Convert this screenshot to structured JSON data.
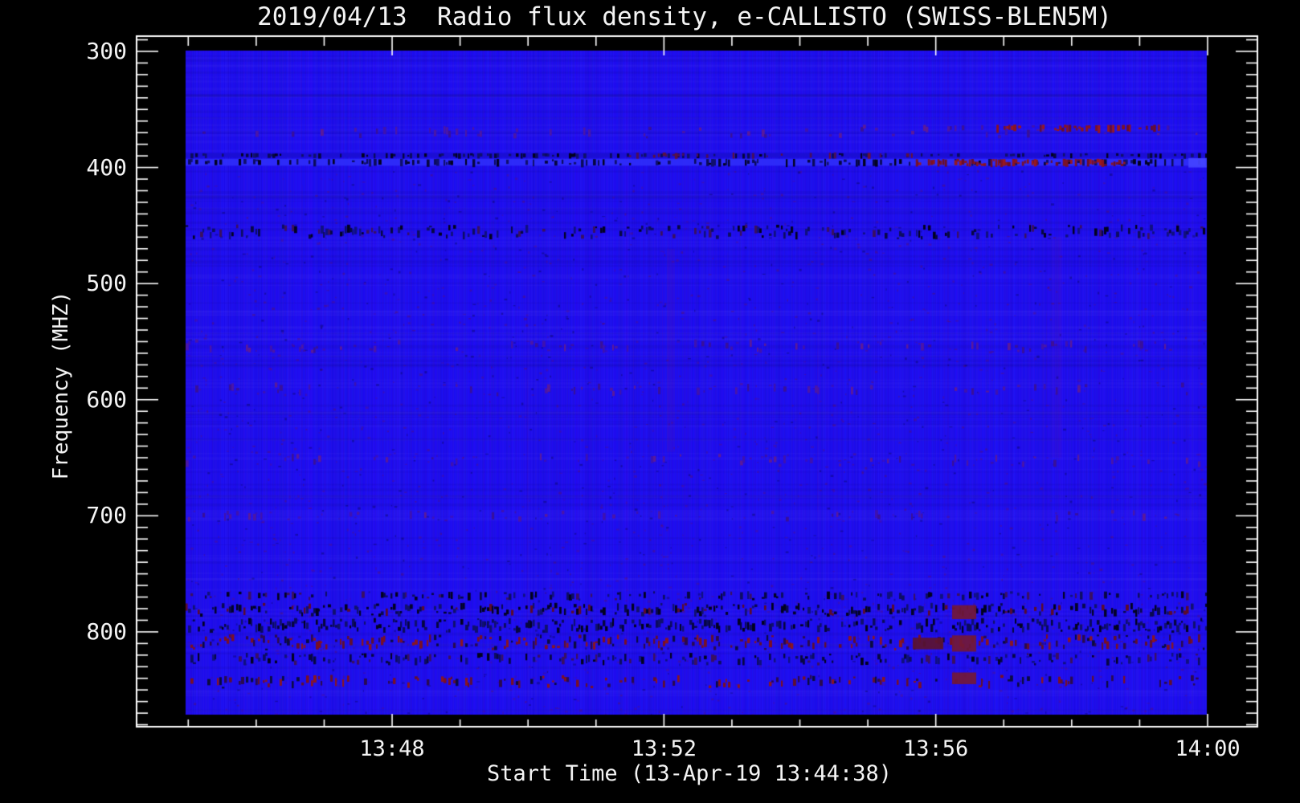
{
  "window": {
    "background": "#000000",
    "text_color": "#f4f4f4",
    "frame_color": "#ffffff"
  },
  "chart_data": {
    "type": "heatmap",
    "title": "2019/04/13  Radio flux density, e-CALLISTO (SWISS-BLEN5M)",
    "xlabel": "Start Time (13-Apr-19 13:44:38)",
    "ylabel": "Frequency (MHZ)",
    "legend": "none",
    "grid": "off",
    "x_axis": {
      "start_time": "13:44:38",
      "end_time": "14:00:00",
      "major_ticks": [
        {
          "label": "13:48",
          "minute": 48
        },
        {
          "label": "13:52",
          "minute": 52
        },
        {
          "label": "13:56",
          "minute": 56
        },
        {
          "label": "14:00",
          "minute": 60
        }
      ],
      "minor_tick_minutes": [
        45,
        46,
        47,
        49,
        50,
        51,
        53,
        54,
        55,
        57,
        58,
        59
      ]
    },
    "y_axis": {
      "unit": "MHZ",
      "direction": "increasing-downward",
      "major_ticks": [
        300,
        400,
        500,
        600,
        700,
        800
      ],
      "minor_step_mhz": 10,
      "minor_range_mhz": [
        290,
        880
      ],
      "image_range_mhz": [
        298,
        872
      ]
    },
    "base_color": "#2111EB",
    "palettes": {
      "dark": [
        "#02021f",
        "#060640",
        "#0b0b5e",
        "#10106e"
      ],
      "darkmix": [
        "#02021f",
        "#070745",
        "#0d0d62",
        "#3a1060",
        "#101080"
      ],
      "mix": [
        "#03032a",
        "#090950",
        "#5c0c2a",
        "#11116e",
        "#02021f"
      ],
      "redmix": [
        "#7a1024",
        "#8a1622",
        "#601030",
        "#2a0a50",
        "#0b0b40"
      ],
      "red": [
        "#8a1420",
        "#7a1228",
        "#981820",
        "#6a0e2a"
      ],
      "redweak": [
        "#5c1240",
        "#4a1058",
        "#6a1236"
      ],
      "purple": [
        "#4a16a8",
        "#3e12b0",
        "#5a1a9a",
        "#38109a"
      ],
      "darkblue": [
        "#1717c8",
        "#1212b4",
        "#0d0da0"
      ],
      "lightblue": [
        "#3333fa",
        "#2b2bf0",
        "#3a3aff"
      ],
      "bright": [
        "#4040ff",
        "#5050ff",
        "#3b3bff"
      ],
      "maroon": [
        "#731937"
      ],
      "maroon2": [
        "#5c1430"
      ]
    },
    "features": [
      {
        "name": "band-368-purple",
        "f0": 363,
        "f1": 375,
        "x0": 0,
        "x1": 1,
        "density": 0.16,
        "palette": "purple"
      },
      {
        "name": "band-366-red",
        "f0": 363,
        "f1": 369,
        "x0": 0.794,
        "x1": 0.963,
        "density": 0.5,
        "palette": "red"
      },
      {
        "name": "line-389",
        "f0": 387.5,
        "f1": 391,
        "x0": 0,
        "x1": 1,
        "density": 0.3,
        "palette": "dark",
        "fill": "#1b0ed2",
        "fillAlpha": 0.9
      },
      {
        "name": "line-389-red",
        "f0": 387,
        "f1": 392,
        "x0": 0.42,
        "x1": 0.715,
        "density": 0.18,
        "palette": "redweak"
      },
      {
        "name": "line-395",
        "f0": 392.5,
        "f1": 398.5,
        "x0": 0,
        "x1": 1,
        "density": 0.35,
        "palette": "dark",
        "fill": "#3030fa",
        "fillAlpha": 0.85
      },
      {
        "name": "line-395-red",
        "f0": 392.5,
        "f1": 399,
        "x0": 0.715,
        "x1": 0.92,
        "density": 0.7,
        "palette": "red"
      },
      {
        "name": "line-395-bright",
        "f0": 392,
        "f1": 400,
        "x0": 0.982,
        "x1": 1.0,
        "density": 0.2,
        "palette": "bright",
        "fill": "#4343ff",
        "fillAlpha": 0.95
      },
      {
        "name": "band-455-dark",
        "f0": 449,
        "f1": 462,
        "x0": 0,
        "x1": 1,
        "density": 0.5,
        "palette": "darkmix"
      },
      {
        "name": "band-554-purple",
        "f0": 548,
        "f1": 560,
        "x0": 0,
        "x1": 1,
        "density": 0.14,
        "palette": "purple"
      },
      {
        "name": "band-590-purple",
        "f0": 585,
        "f1": 597,
        "x0": 0,
        "x1": 1,
        "density": 0.1,
        "palette": "purple"
      },
      {
        "name": "band-652-purple",
        "f0": 646,
        "f1": 658,
        "x0": 0,
        "x1": 1,
        "density": 0.1,
        "palette": "purple"
      },
      {
        "name": "band-700-purple",
        "f0": 695,
        "f1": 706,
        "x0": 0,
        "x1": 1,
        "density": 0.07,
        "palette": "purple"
      },
      {
        "name": "band-769-speckle",
        "f0": 765,
        "f1": 773,
        "x0": 0,
        "x1": 1,
        "density": 0.3,
        "palette": "darkmix"
      },
      {
        "name": "band-781-heavy",
        "f0": 775,
        "f1": 787,
        "x0": 0,
        "x1": 1,
        "density": 0.58,
        "palette": "mix"
      },
      {
        "name": "band-794-black",
        "f0": 788,
        "f1": 801,
        "x0": 0,
        "x1": 1,
        "density": 0.66,
        "palette": "dark"
      },
      {
        "name": "band-809-red",
        "f0": 802,
        "f1": 816,
        "x0": 0,
        "x1": 1,
        "density": 0.55,
        "palette": "redmix"
      },
      {
        "name": "band-823-dark",
        "f0": 818,
        "f1": 829,
        "x0": 0,
        "x1": 1,
        "density": 0.45,
        "palette": "darkmix"
      },
      {
        "name": "band-843-red",
        "f0": 837,
        "f1": 849,
        "x0": 0,
        "x1": 1,
        "density": 0.3,
        "palette": "redmix"
      }
    ],
    "patches": [
      {
        "name": "maroon-block-1",
        "x0": 0.7506,
        "x1": 0.7742,
        "f0": 777,
        "f1": 789,
        "palette": "maroon"
      },
      {
        "name": "maroon-block-2",
        "x0": 0.7506,
        "x1": 0.7742,
        "f0": 803,
        "f1": 817,
        "palette": "maroon"
      },
      {
        "name": "maroon-block-3",
        "x0": 0.7506,
        "x1": 0.7742,
        "f0": 835,
        "f1": 845,
        "palette": "maroon"
      },
      {
        "name": "maroon-block-4",
        "x0": 0.712,
        "x1": 0.742,
        "f0": 805,
        "f1": 815,
        "palette": "maroon2"
      }
    ],
    "streaks": [
      {
        "name": "faint-streak-1",
        "x": 0.4752,
        "f0": 470,
        "f1": 645,
        "w": 10,
        "color": "rgba(130,25,120,0.10)"
      },
      {
        "name": "faint-streak-2",
        "x": 0.8529,
        "f0": 460,
        "f1": 650,
        "w": 13,
        "color": "rgba(130,25,120,0.09)"
      }
    ]
  }
}
